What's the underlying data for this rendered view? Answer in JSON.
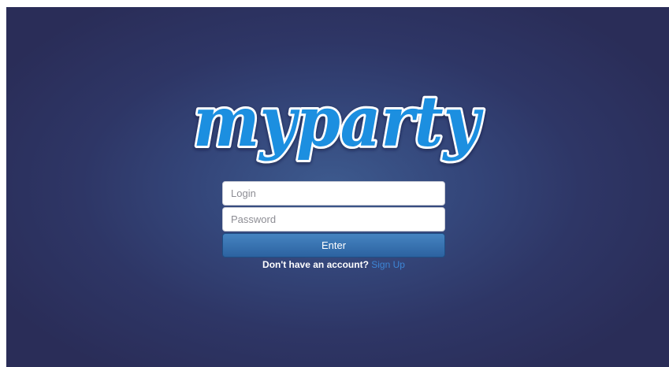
{
  "brand": {
    "logo_text": "myparty",
    "logo_color": "#1b8fe0",
    "logo_outline_color": "#ffffff"
  },
  "login_form": {
    "login_placeholder": "Login",
    "login_value": "",
    "password_placeholder": "Password",
    "password_value": "",
    "enter_label": "Enter",
    "signup_prompt": "Don't have an account?",
    "signup_link_label": "Sign Up",
    "button_color": "#3671b0",
    "link_color": "#3d86d6"
  },
  "background": {
    "center_color": "#3d5a8e",
    "edge_color": "#2a2d58"
  }
}
